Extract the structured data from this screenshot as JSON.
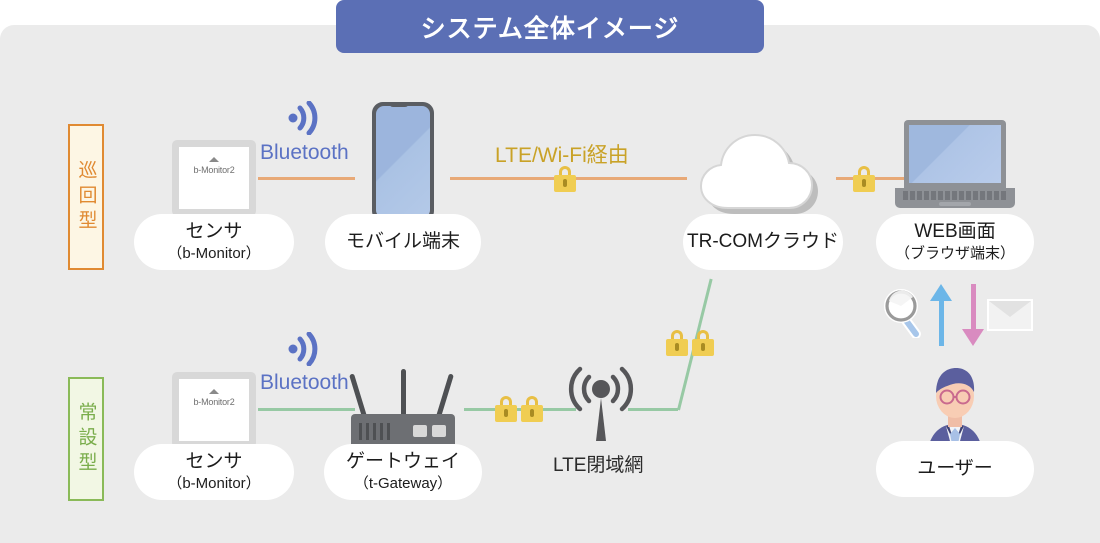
{
  "header": {
    "title": "システム全体イメージ",
    "banner_color": "#5b6fb5"
  },
  "side_labels": [
    {
      "name": "patrol",
      "text": "巡回型",
      "color": "#e08a32",
      "bg": "#fdf6e4"
    },
    {
      "name": "permanent",
      "text": "常設型",
      "color": "#7aad4b",
      "bg": "#f2f7e4"
    }
  ],
  "rows": {
    "patrol": {
      "nodes": [
        {
          "id": "sensor",
          "label": "センサ",
          "sublabel": "（b-Monitor）",
          "screen_text": "b-Monitor2"
        },
        {
          "id": "mobile",
          "label": "モバイル端末",
          "sublabel": ""
        },
        {
          "id": "cloud",
          "label": "TR-COMクラウド",
          "sublabel": ""
        },
        {
          "id": "web",
          "label": "WEB画面",
          "sublabel": "（ブラウザ端末）"
        }
      ],
      "connections": [
        {
          "id": "bluetooth",
          "label": "Bluetooth",
          "color": "#5b72c4",
          "line_color": "#e8a977",
          "locks": 0
        },
        {
          "id": "lte-wifi",
          "label": "LTE/Wi-Fi経由",
          "color": "#c9a227",
          "line_color": "#e8a977",
          "locks": 1
        },
        {
          "id": "cloud-web",
          "label": "",
          "line_color": "#e8a977",
          "locks": 1
        }
      ]
    },
    "permanent": {
      "nodes": [
        {
          "id": "sensor2",
          "label": "センサ",
          "sublabel": "（b-Monitor）",
          "screen_text": "b-Monitor2"
        },
        {
          "id": "gateway",
          "label": "ゲートウェイ",
          "sublabel": "（t-Gateway）"
        },
        {
          "id": "lte-network",
          "label": "LTE閉域網",
          "sublabel": ""
        },
        {
          "id": "user",
          "label": "ユーザー",
          "sublabel": ""
        }
      ],
      "connections": [
        {
          "id": "bluetooth2",
          "label": "Bluetooth",
          "color": "#5b72c4",
          "line_color": "#97c9a4",
          "locks": 0
        },
        {
          "id": "gw-lte",
          "label": "",
          "line_color": "#97c9a4",
          "locks": 2
        },
        {
          "id": "lte-cloud",
          "label": "",
          "line_color": "#97c9a4",
          "locks": 2
        }
      ]
    }
  },
  "user_actions": {
    "search_icon": "magnifier-icon",
    "upload_arrow": "arrow-up",
    "download_arrow": "arrow-down",
    "mail_icon": "envelope-icon",
    "upload_color": "#6cb6e8",
    "download_color": "#d98bc0"
  },
  "icons": {
    "bluetooth": "bluetooth-wave-icon",
    "lock": "padlock-icon",
    "cloud": "cloud-icon",
    "router": "router-icon",
    "tower": "antenna-tower-icon",
    "laptop": "laptop-icon",
    "phone": "smartphone-icon",
    "sensor": "sensor-monitor-icon",
    "avatar": "user-avatar-icon"
  }
}
